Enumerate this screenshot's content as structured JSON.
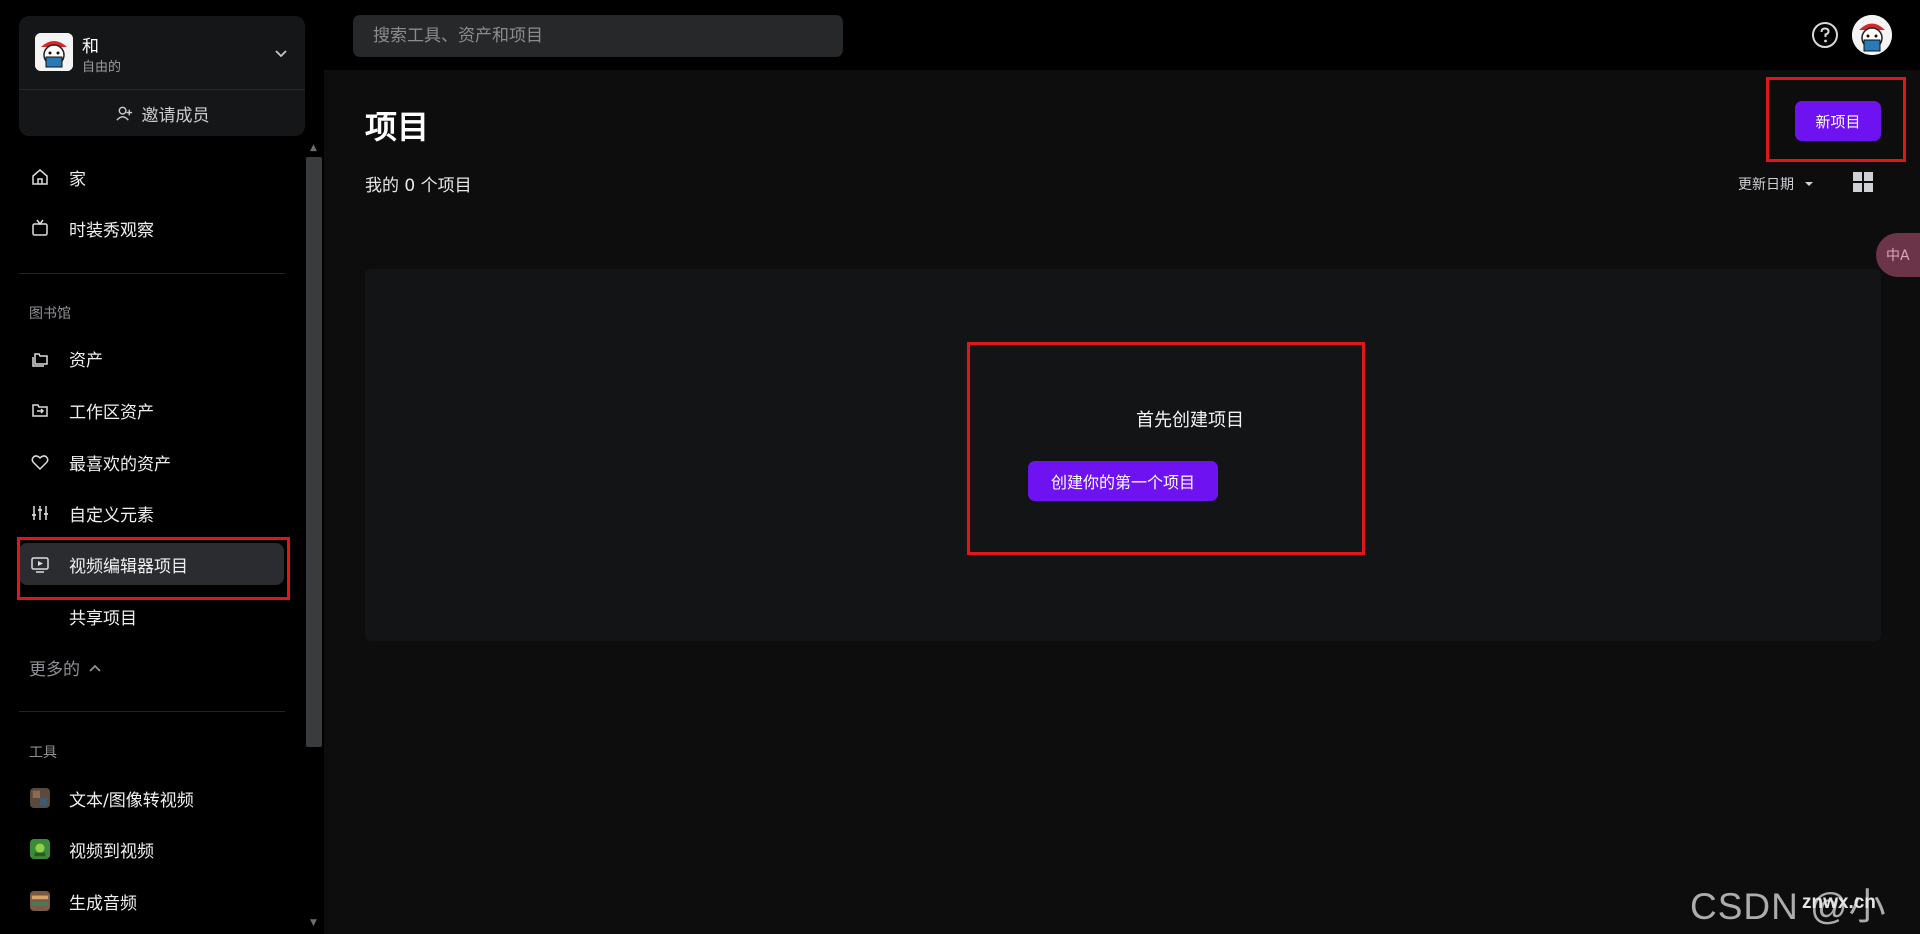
{
  "workspace": {
    "name": "和",
    "plan": "自由的",
    "invite_label": "邀请成员"
  },
  "search": {
    "placeholder": "搜索工具、资产和项目"
  },
  "nav_top": [
    {
      "label": "家",
      "icon": "home-icon"
    },
    {
      "label": "时装秀观察",
      "icon": "tv-icon"
    }
  ],
  "library": {
    "title": "图书馆",
    "items": [
      {
        "label": "资产",
        "icon": "folders-icon"
      },
      {
        "label": "工作区资产",
        "icon": "folder-share-icon"
      },
      {
        "label": "最喜欢的资产",
        "icon": "heart-icon"
      },
      {
        "label": "自定义元素",
        "icon": "sliders-icon"
      },
      {
        "label": "视频编辑器项目",
        "icon": "video-editor-icon",
        "active": true
      },
      {
        "label": "共享项目"
      }
    ],
    "more_label": "更多的"
  },
  "tools": {
    "title": "工具",
    "items": [
      {
        "label": "文本/图像转视频",
        "icon": "text-image-video-thumb"
      },
      {
        "label": "视频到视频",
        "icon": "video-to-video-thumb"
      },
      {
        "label": "生成音频",
        "icon": "audio-thumb"
      }
    ]
  },
  "main": {
    "title": "项目",
    "subtitle": "我的 0 个项目",
    "new_project_label": "新项目",
    "sort_label": "更新日期",
    "empty_text": "首先创建项目",
    "create_first_label": "创建你的第一个项目"
  },
  "translate_tab": "中A",
  "watermark": {
    "text": "CSDN @小 Z",
    "site": "znwx.cn"
  },
  "colors": {
    "accent": "#6e12f2",
    "highlight": "#e0161d",
    "sidebar_bg": "#000000",
    "main_bg": "#0d0d0d"
  }
}
